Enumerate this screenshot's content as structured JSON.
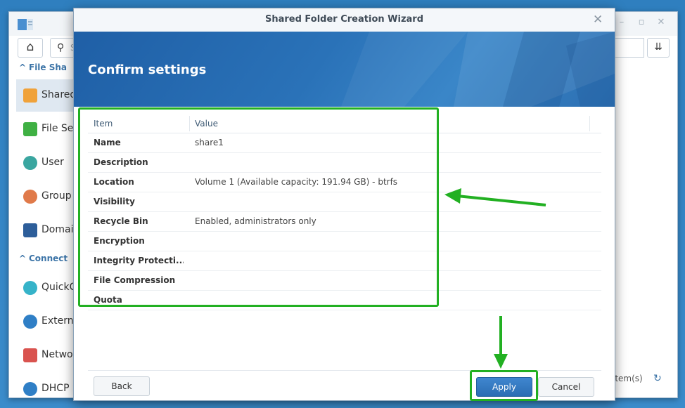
{
  "control_panel": {
    "search_placeholder": "S",
    "sections": [
      {
        "label": "File Sha"
      },
      {
        "label": "Connect"
      }
    ],
    "items": [
      {
        "label": "Shared",
        "icon": "shared-folder-icon",
        "active": true
      },
      {
        "label": "File Se",
        "icon": "file-services-icon"
      },
      {
        "label": "User",
        "icon": "user-icon"
      },
      {
        "label": "Group",
        "icon": "group-icon"
      },
      {
        "label": "Domain",
        "icon": "domain-icon"
      },
      {
        "label": "QuickC",
        "icon": "quickconnect-icon"
      },
      {
        "label": "Extern",
        "icon": "external-access-icon"
      },
      {
        "label": "Netwo",
        "icon": "network-icon"
      },
      {
        "label": "DHCP S",
        "icon": "dhcp-icon"
      }
    ],
    "footer_count": "item(s)"
  },
  "wizard": {
    "title": "Shared Folder Creation Wizard",
    "header_title": "Confirm settings",
    "table": {
      "columns": [
        "Item",
        "Value"
      ],
      "rows": [
        {
          "item": "Name",
          "value": "share1"
        },
        {
          "item": "Description",
          "value": ""
        },
        {
          "item": "Location",
          "value": "Volume 1 (Available capacity: 191.94 GB) - btrfs"
        },
        {
          "item": "Visibility",
          "value": ""
        },
        {
          "item": "Recycle Bin",
          "value": "Enabled, administrators only"
        },
        {
          "item": "Encryption",
          "value": ""
        },
        {
          "item": "Integrity Protecti...",
          "value": ""
        },
        {
          "item": "File Compression",
          "value": ""
        },
        {
          "item": "Quota",
          "value": ""
        }
      ]
    },
    "buttons": {
      "back": "Back",
      "apply": "Apply",
      "cancel": "Cancel"
    }
  },
  "colors": {
    "annotation_green": "#22b022",
    "header_blue": "#2a72b8",
    "apply_blue": "#2b6db3"
  }
}
